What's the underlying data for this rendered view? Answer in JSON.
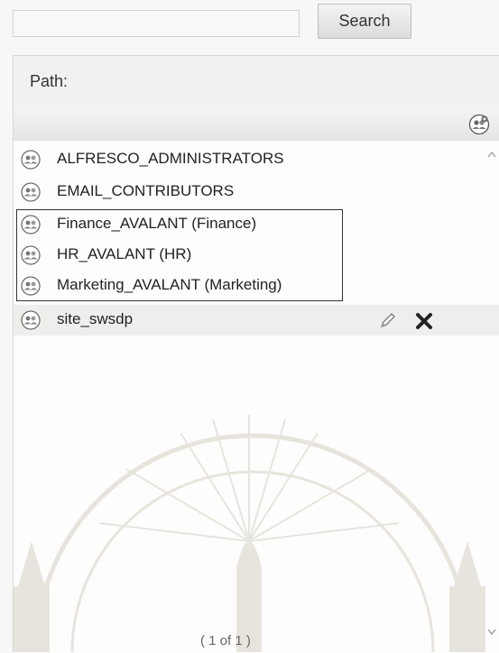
{
  "search": {
    "value": "",
    "placeholder": "",
    "button_label": "Search"
  },
  "path": {
    "label": "Path:"
  },
  "toolbar": {
    "new_group_icon": "new-group-icon"
  },
  "groups": [
    {
      "label": "ALFRESCO_ADMINISTRATORS",
      "icon": "group-icon"
    },
    {
      "label": "EMAIL_CONTRIBUTORS",
      "icon": "group-icon"
    },
    {
      "label": "Finance_AVALANT (Finance)",
      "icon": "group-icon",
      "highlighted": true
    },
    {
      "label": "HR_AVALANT (HR)",
      "icon": "group-icon",
      "highlighted": true
    },
    {
      "label": "Marketing_AVALANT (Marketing)",
      "icon": "group-icon",
      "highlighted": true
    },
    {
      "label": "site_swsdp",
      "icon": "group-icon",
      "hovered": true,
      "actions": [
        "edit-icon",
        "delete-icon"
      ]
    }
  ],
  "paging": {
    "text": "( 1 of 1 )"
  },
  "colors": {
    "highlight_border": "#333333",
    "hover_row": "#eeeeec",
    "delete": "#222222"
  }
}
